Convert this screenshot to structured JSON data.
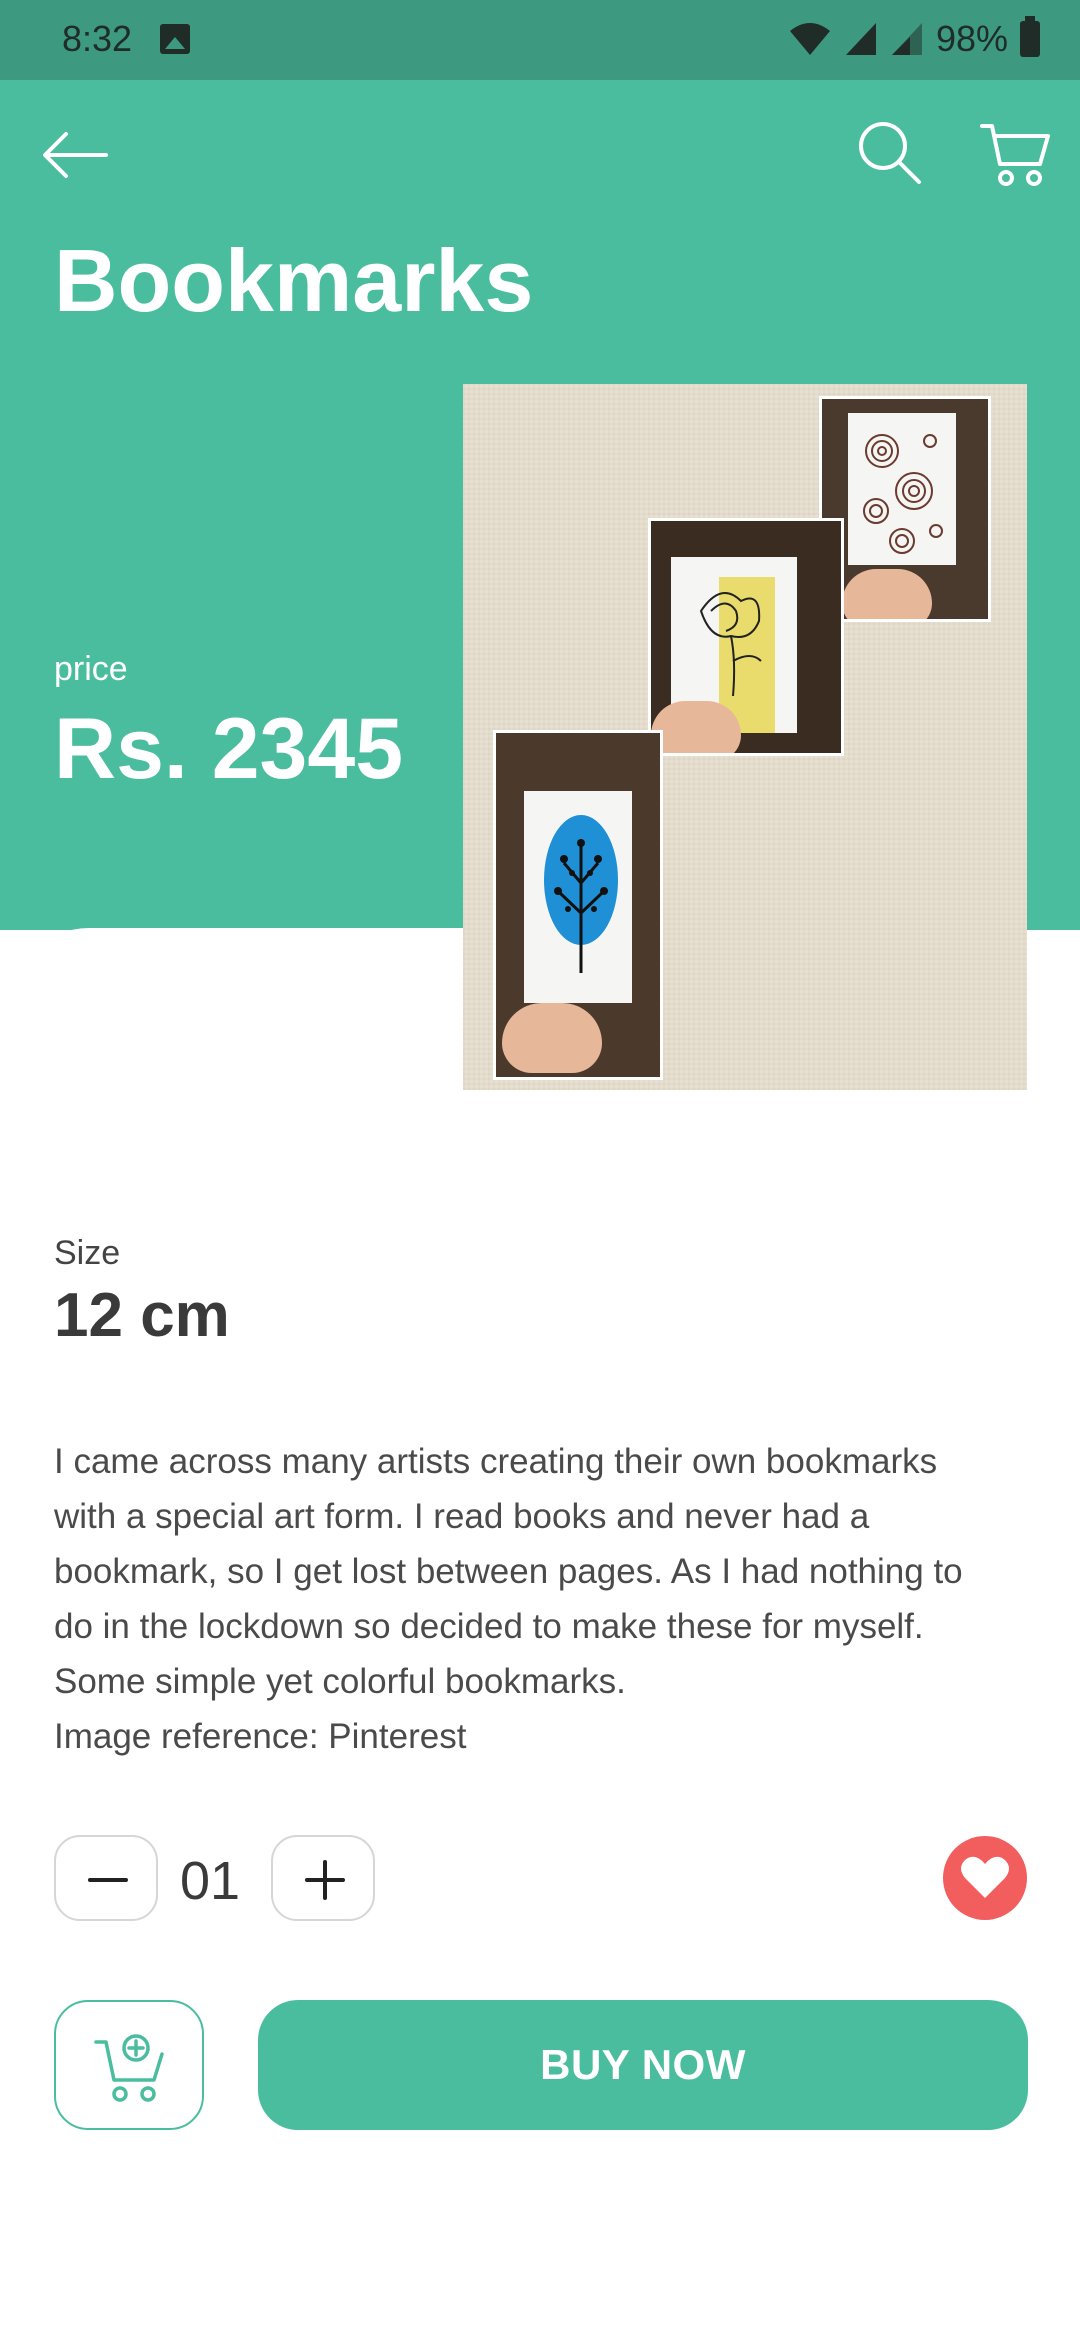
{
  "status_bar": {
    "time": "8:32",
    "battery": "98%",
    "icons": [
      "image-icon",
      "wifi-icon",
      "signal-icon",
      "signal-icon",
      "battery-icon"
    ]
  },
  "header": {
    "back_icon": "back-arrow-icon",
    "search_icon": "search-icon",
    "cart_icon": "cart-icon",
    "title": "Bookmarks"
  },
  "product": {
    "price_label": "price",
    "price": "Rs. 2345",
    "image_description": "three hand-drawn bookmarks",
    "size_label": "Size",
    "size_value": "12 cm",
    "description_lines": [
      "I came across many artists creating their own bookmarks",
      "with a special art form. I read books and never had a",
      "bookmark, so I get lost between pages. As I had nothing to",
      "do in the lockdown so decided to make these for myself.",
      "Some simple yet colorful bookmarks.",
      "Image reference: Pinterest"
    ]
  },
  "quantity": {
    "value": "01",
    "minus_icon": "minus-icon",
    "plus_icon": "plus-icon"
  },
  "actions": {
    "favorite_icon": "heart-icon",
    "add_to_cart_icon": "cart-add-icon",
    "buy_label": "BUY NOW"
  },
  "colors": {
    "primary": "#4abd9f",
    "status_bar": "#3d9a80",
    "favorite": "#f25d5d"
  }
}
